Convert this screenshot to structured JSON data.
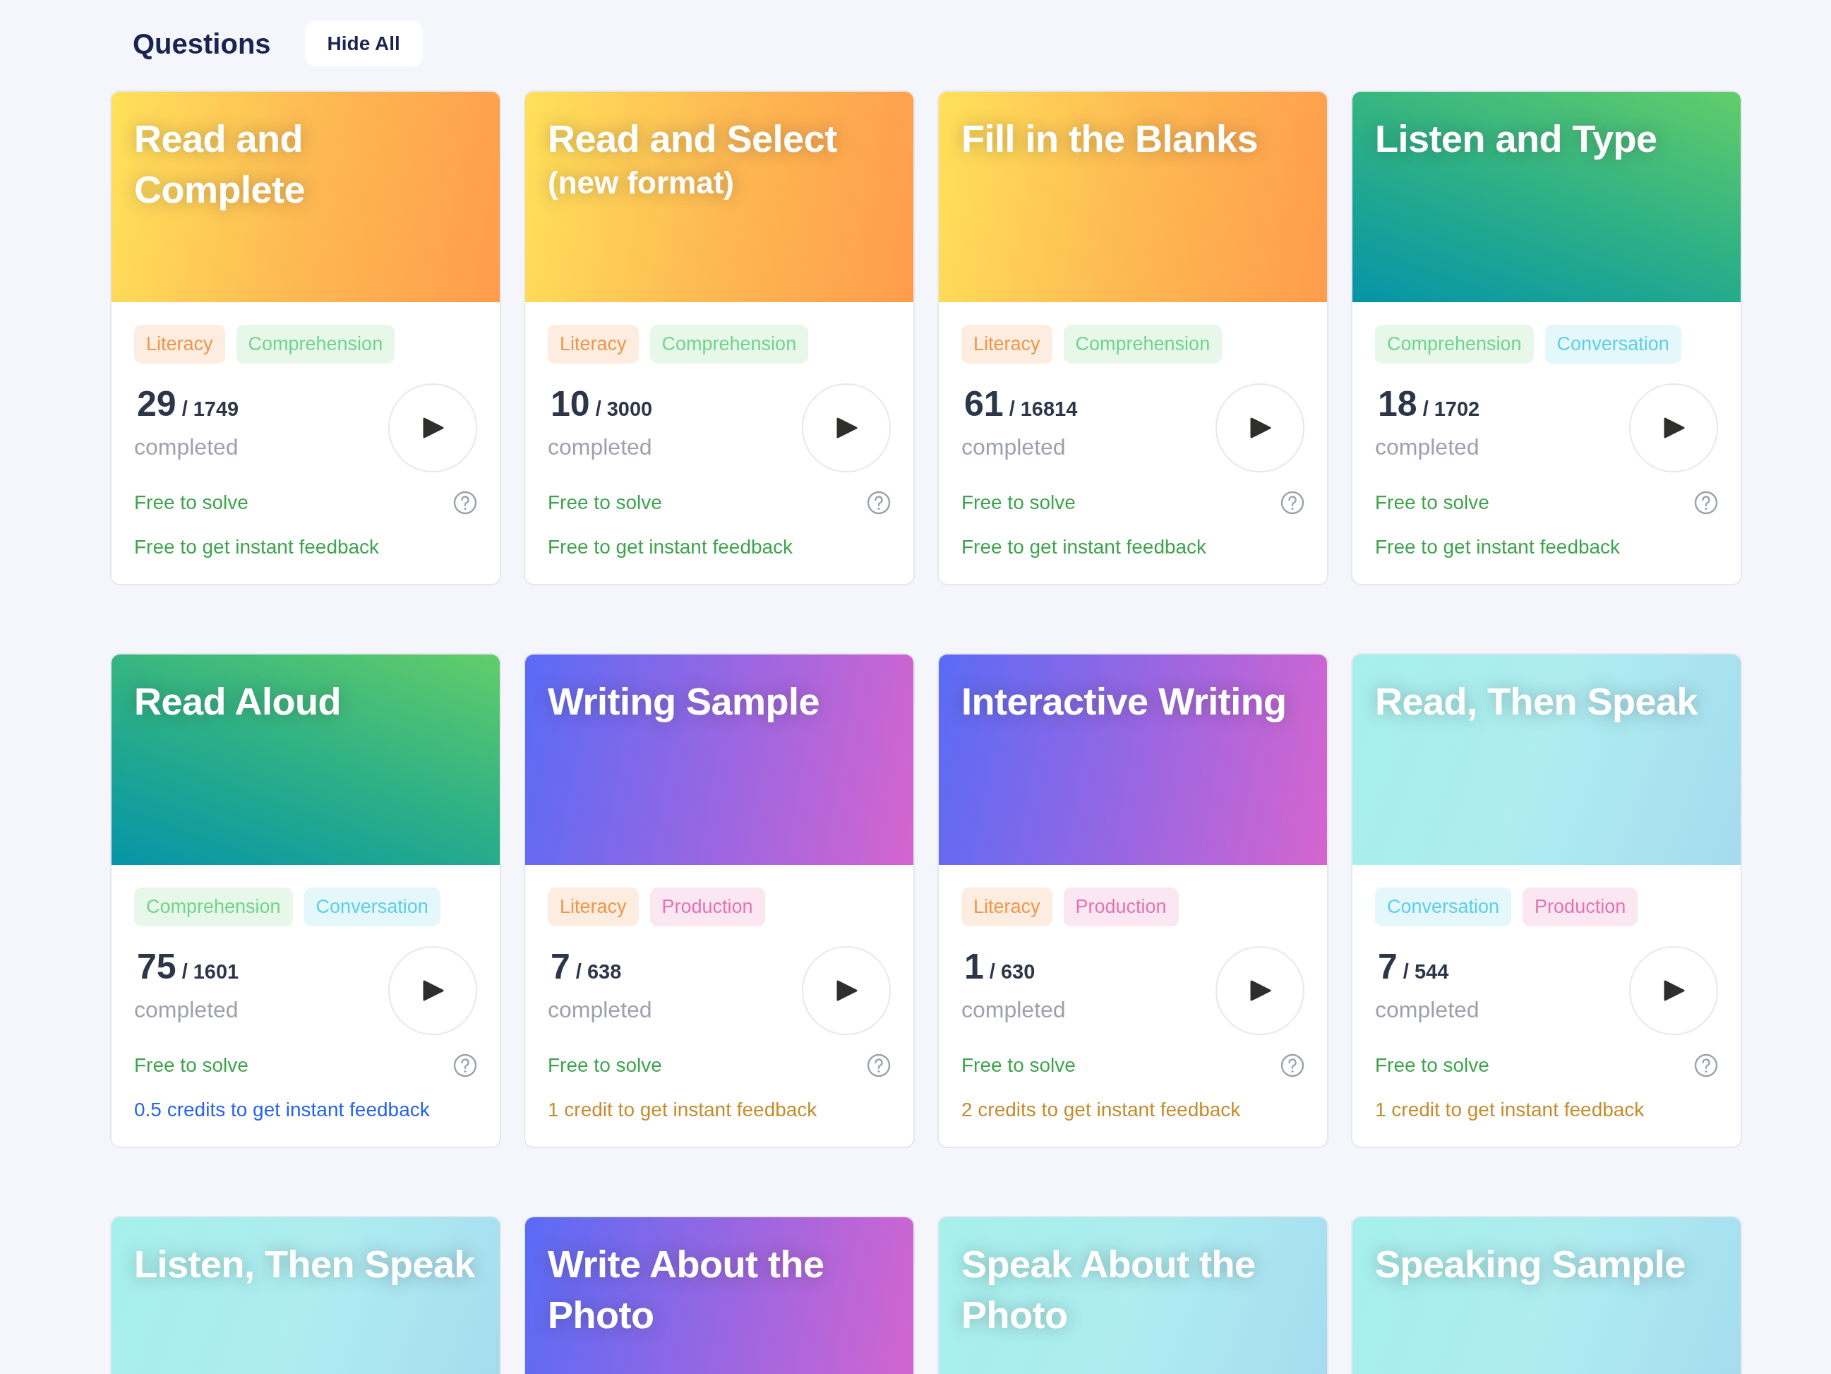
{
  "header": {
    "title": "Questions",
    "hide_button": "Hide All"
  },
  "cards": [
    {
      "title": "Read and Complete",
      "kind": "orange",
      "tags": [
        {
          "label": "Literacy",
          "color": "#f0954a"
        },
        {
          "label": "Comprehension",
          "color": "#6fd489"
        }
      ],
      "done": "29",
      "total": "/ 1749",
      "completed_label": "completed",
      "solve": "Free to solve",
      "feedback": {
        "text": "Free to get instant feedback",
        "color": "#3fa34d"
      }
    },
    {
      "title": "Read and Select",
      "subtitle": "(new format)",
      "kind": "orange",
      "tags": [
        {
          "label": "Literacy",
          "color": "#f0954a"
        },
        {
          "label": "Comprehension",
          "color": "#6fd489"
        }
      ],
      "done": "10",
      "total": "/ 3000",
      "completed_label": "completed",
      "solve": "Free to solve",
      "feedback": {
        "text": "Free to get instant feedback",
        "color": "#3fa34d"
      }
    },
    {
      "title": "Fill in the Blanks",
      "kind": "orange",
      "tags": [
        {
          "label": "Literacy",
          "color": "#f0954a"
        },
        {
          "label": "Comprehension",
          "color": "#6fd489"
        }
      ],
      "done": "61",
      "total": "/ 16814",
      "completed_label": "completed",
      "solve": "Free to solve",
      "feedback": {
        "text": "Free to get instant feedback",
        "color": "#3fa34d"
      }
    },
    {
      "title": "Listen and Type",
      "kind": "teal",
      "tags": [
        {
          "label": "Comprehension",
          "color": "#6fd489"
        },
        {
          "label": "Conversation",
          "color": "#5ccfe6"
        }
      ],
      "done": "18",
      "total": "/ 1702",
      "completed_label": "completed",
      "solve": "Free to solve",
      "feedback": {
        "text": "Free to get instant feedback",
        "color": "#3fa34d"
      }
    },
    {
      "title": "Read Aloud",
      "kind": "teal",
      "tags": [
        {
          "label": "Comprehension",
          "color": "#6fd489"
        },
        {
          "label": "Conversation",
          "color": "#5ccfe6"
        }
      ],
      "done": "75",
      "total": "/ 1601",
      "completed_label": "completed",
      "solve": "Free to solve",
      "feedback": {
        "text": "0.5 credits to get instant feedback",
        "color": "#2563eb"
      }
    },
    {
      "title": "Writing Sample",
      "kind": "purple",
      "tags": [
        {
          "label": "Literacy",
          "color": "#f0954a"
        },
        {
          "label": "Production",
          "color": "#e572b3"
        }
      ],
      "done": "7",
      "total": "/ 638",
      "completed_label": "completed",
      "solve": "Free to solve",
      "feedback": {
        "text": "1 credit to get instant feedback",
        "color": "#c58c2c"
      }
    },
    {
      "title": "Interactive Writing",
      "kind": "purple",
      "tags": [
        {
          "label": "Literacy",
          "color": "#f0954a"
        },
        {
          "label": "Production",
          "color": "#e572b3"
        }
      ],
      "done": "1",
      "total": "/ 630",
      "completed_label": "completed",
      "solve": "Free to solve",
      "feedback": {
        "text": "2 credits to get instant feedback",
        "color": "#c58c2c"
      }
    },
    {
      "title": "Read, Then Speak",
      "kind": "aqua",
      "tags": [
        {
          "label": "Conversation",
          "color": "#5ccfe6"
        },
        {
          "label": "Production",
          "color": "#e572b3"
        }
      ],
      "done": "7",
      "total": "/ 544",
      "completed_label": "completed",
      "solve": "Free to solve",
      "feedback": {
        "text": "1 credit to get instant feedback",
        "color": "#c58c2c"
      }
    },
    {
      "title": "Listen, Then Speak",
      "kind": "aqua"
    },
    {
      "title": "Write About the Photo",
      "kind": "purple"
    },
    {
      "title": "Speak About the Photo",
      "kind": "aqua"
    },
    {
      "title": "Speaking Sample",
      "kind": "aqua"
    }
  ]
}
